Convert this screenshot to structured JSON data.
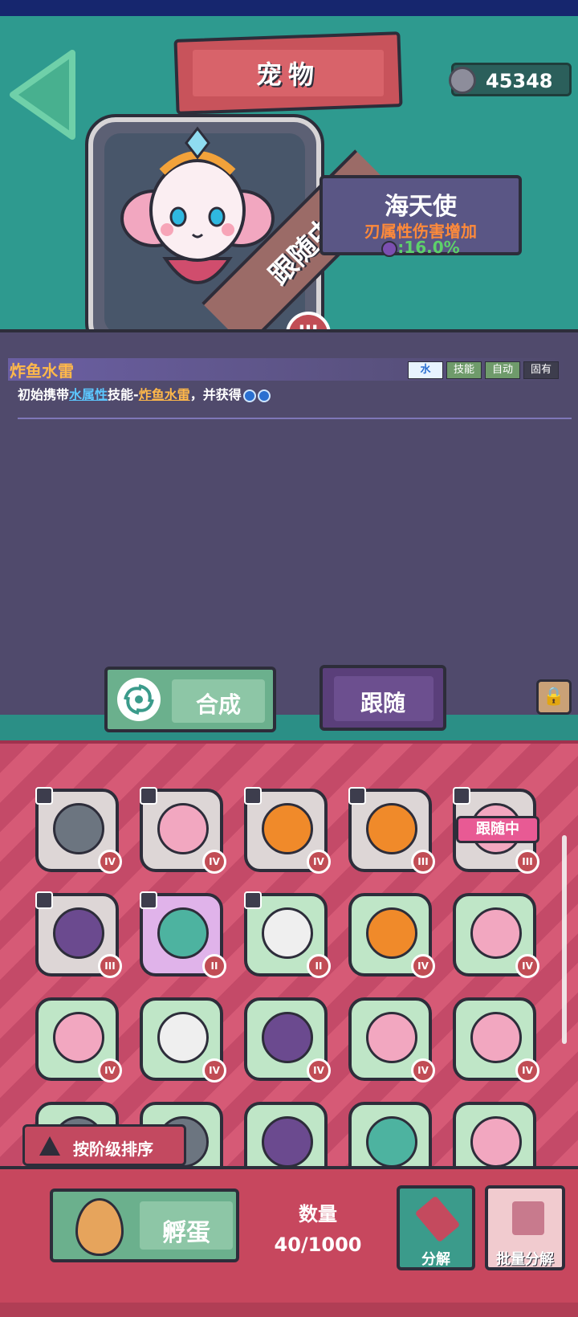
{
  "header": {
    "title": "宠物",
    "currency": "45348"
  },
  "pet": {
    "name": "海天使",
    "effect": "刃属性伤害增加",
    "bonus": ":16.0%",
    "status_ribbon": "跟随中",
    "rank": "III"
  },
  "skill": {
    "name": "炸鱼水雷",
    "tags": [
      "水",
      "技能",
      "自动",
      "固有"
    ],
    "desc_prefix": "初始携带",
    "desc_hl1": "水属性",
    "desc_mid": "技能-",
    "desc_hl2": "炸鱼水雷",
    "desc_suffix": "，并获得"
  },
  "actions": {
    "synth_label": "合成",
    "follow_label": "跟随"
  },
  "grid": {
    "follow_badge": "跟随中",
    "tiles": [
      {
        "bg": "gray",
        "rank": "IV",
        "locked": true,
        "creature": "#6c7580"
      },
      {
        "bg": "gray",
        "rank": "IV",
        "locked": true,
        "creature": "#f2a7c0"
      },
      {
        "bg": "gray",
        "rank": "IV",
        "locked": true,
        "creature": "#f08a2a"
      },
      {
        "bg": "gray",
        "rank": "III",
        "locked": true,
        "creature": "#f08a2a"
      },
      {
        "bg": "gray",
        "rank": "III",
        "locked": true,
        "creature": "#f2a7c0",
        "follow": true
      },
      {
        "bg": "gray",
        "rank": "III",
        "locked": true,
        "creature": "#6b4a8f"
      },
      {
        "bg": "purple",
        "rank": "II",
        "locked": true,
        "creature": "#4db3a0"
      },
      {
        "bg": "green",
        "rank": "II",
        "locked": true,
        "creature": "#efefef"
      },
      {
        "bg": "green",
        "rank": "IV",
        "locked": false,
        "creature": "#f08a2a"
      },
      {
        "bg": "green",
        "rank": "IV",
        "locked": false,
        "creature": "#f2a7c0"
      },
      {
        "bg": "green",
        "rank": "IV",
        "locked": false,
        "creature": "#f2a7c0"
      },
      {
        "bg": "green",
        "rank": "IV",
        "locked": false,
        "creature": "#efefef"
      },
      {
        "bg": "green",
        "rank": "IV",
        "locked": false,
        "creature": "#6b4a8f"
      },
      {
        "bg": "green",
        "rank": "IV",
        "locked": false,
        "creature": "#f2a7c0"
      },
      {
        "bg": "green",
        "rank": "IV",
        "locked": false,
        "creature": "#f2a7c0"
      },
      {
        "bg": "green",
        "rank": "",
        "locked": false,
        "creature": "#6c7580"
      },
      {
        "bg": "green",
        "rank": "",
        "locked": false,
        "creature": "#6c7580"
      },
      {
        "bg": "green",
        "rank": "",
        "locked": false,
        "creature": "#6b4a8f"
      },
      {
        "bg": "green",
        "rank": "",
        "locked": false,
        "creature": "#4db3a0"
      },
      {
        "bg": "green",
        "rank": "",
        "locked": false,
        "creature": "#f2a7c0"
      }
    ]
  },
  "footer": {
    "sort_label": "按阶级排序",
    "hatch_label": "孵蛋",
    "count_label": "数量",
    "count_value": "40/1000",
    "decompose_label": "分解",
    "batch_decompose_label": "批量分解"
  }
}
